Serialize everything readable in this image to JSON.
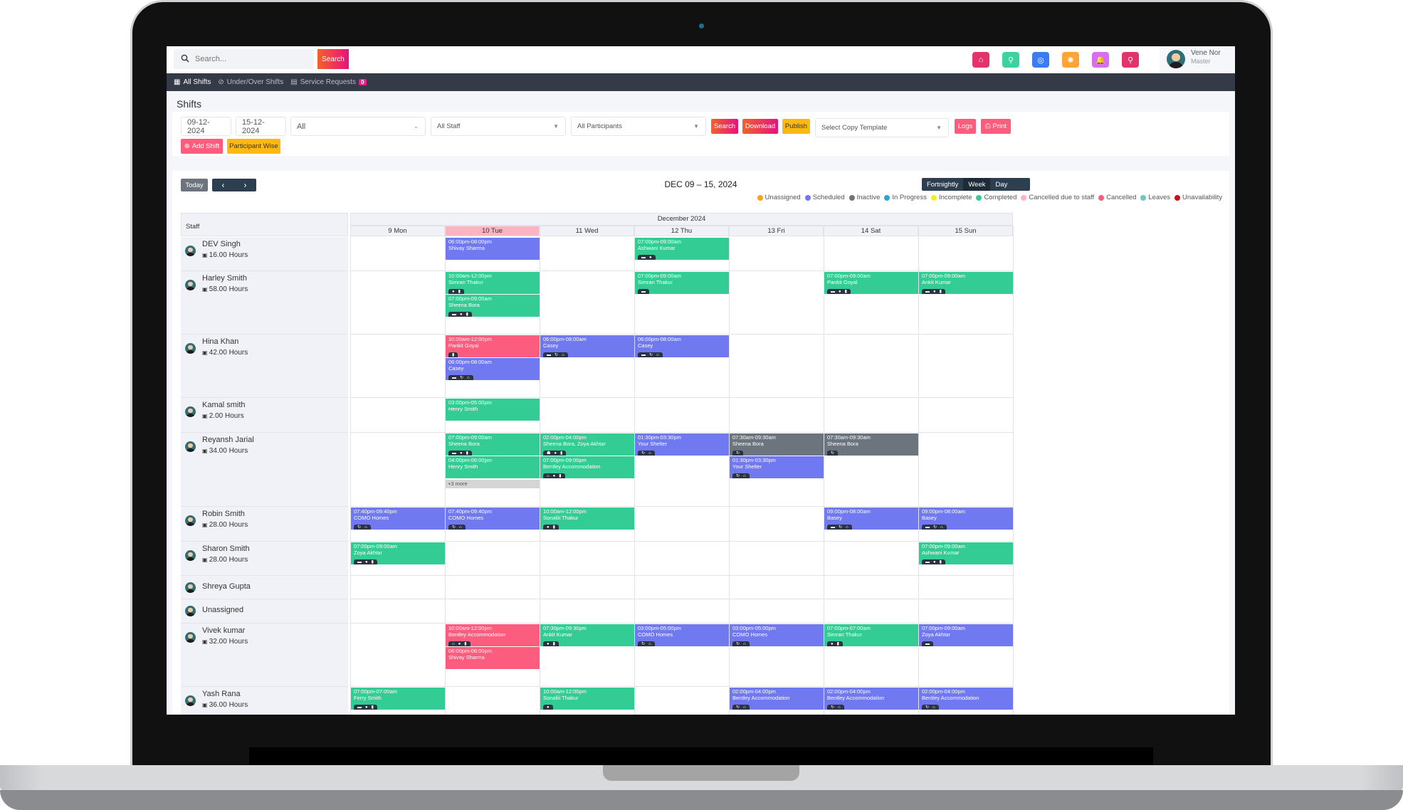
{
  "topbar": {
    "search_placeholder": "Search...",
    "search_button": "Search",
    "icons": [
      {
        "name": "home-icon",
        "glyph": "⌂",
        "color": "#e3336b"
      },
      {
        "name": "location-icon",
        "glyph": "⚲",
        "color": "#3bd3a0"
      },
      {
        "name": "lifebuoy-icon",
        "glyph": "◎",
        "color": "#3d7cf0"
      },
      {
        "name": "gear-icon",
        "glyph": "✺",
        "color": "#fea43b"
      },
      {
        "name": "bell-icon",
        "glyph": "🔔",
        "color": "#d76ef0"
      },
      {
        "name": "map-pin-icon",
        "glyph": "⚲",
        "color": "#e3336b"
      }
    ],
    "user_name": "Vene Nor",
    "user_role": "Master"
  },
  "nav": {
    "items": [
      {
        "label": "All Shifts",
        "icon": "▦",
        "active": true
      },
      {
        "label": "Under/Over Shifts",
        "icon": "⊘",
        "active": false
      },
      {
        "label": "Service Requests",
        "icon": "▤",
        "active": false,
        "badge": "0"
      }
    ]
  },
  "page": {
    "title": "Shifts"
  },
  "filters": {
    "start_date": "09-12-2024",
    "end_date": "15-12-2024",
    "status_select": "All",
    "staff_select": "All Staff",
    "participants_select": "All Participants",
    "search_label": "Search",
    "download_label": "Download",
    "publish_label": "Publish",
    "copy_template_placeholder": "Select Copy Template",
    "logs_label": "Logs",
    "print_label": "Print",
    "add_shift_label": "Add Shift",
    "participant_wise_label": "Participant Wise"
  },
  "calendar": {
    "today_label": "Today",
    "prev": "‹",
    "next": "›",
    "title": "DEC 09 – 15, 2024",
    "views": [
      "Fortnightly",
      "Week",
      "Day"
    ],
    "active_view": "Week",
    "staff_header": "Staff",
    "month_header": "December 2024",
    "days": [
      "9 Mon",
      "10 Tue",
      "11 Wed",
      "12 Thu",
      "13 Fri",
      "14 Sat",
      "15 Sun"
    ],
    "today_index": 1,
    "more_label": "+3 more"
  },
  "legend": [
    {
      "label": "Unassigned",
      "color": "#f7a21b"
    },
    {
      "label": "Scheduled",
      "color": "#7079f0"
    },
    {
      "label": "Inactive",
      "color": "#6c757d"
    },
    {
      "label": "In Progress",
      "color": "#2fa3d6"
    },
    {
      "label": "Incomplete",
      "color": "#f4ef1c"
    },
    {
      "label": "Completed",
      "color": "#33cc95"
    },
    {
      "label": "Cancelled due to staff",
      "color": "#fdb3c1"
    },
    {
      "label": "Cancelled",
      "color": "#fc5c7d"
    },
    {
      "label": "Leaves",
      "color": "#6fc7c0"
    },
    {
      "label": "Unavailability",
      "color": "#c0131e"
    }
  ],
  "staff": [
    {
      "name": "DEV Singh",
      "hours": "16.00 Hours"
    },
    {
      "name": "Harley Smith",
      "hours": "58.00 Hours"
    },
    {
      "name": "Hina Khan",
      "hours": "42.00 Hours"
    },
    {
      "name": "Kamal smith",
      "hours": "2.00 Hours"
    },
    {
      "name": "Reyansh Jarial",
      "hours": "34.00 Hours"
    },
    {
      "name": "Robin Smith",
      "hours": "28.00 Hours"
    },
    {
      "name": "Sharon Smith",
      "hours": "28.00 Hours"
    },
    {
      "name": "Shreya Gupta",
      "hours": ""
    },
    {
      "name": "Unassigned",
      "hours": ""
    },
    {
      "name": "Vivek kumar",
      "hours": "32.00 Hours"
    },
    {
      "name": "Yash Rana",
      "hours": "36.00 Hours"
    }
  ],
  "shifts": [
    {
      "staff": 0,
      "day": 1,
      "slot": 0,
      "time": "06:00pm-08:00pm",
      "who": "Shivay Sharma",
      "status": "scheduled",
      "icons": []
    },
    {
      "staff": 0,
      "day": 3,
      "slot": 0,
      "time": "07:00pm-09:00am",
      "who": "Ashwani Kumar",
      "status": "completed",
      "icons": [
        "bed",
        "check"
      ]
    },
    {
      "staff": 1,
      "day": 1,
      "slot": 0,
      "time": "10:00am-12:00pm",
      "who": "Simran Thakur",
      "status": "completed",
      "icons": [
        "check",
        "lock"
      ]
    },
    {
      "staff": 1,
      "day": 1,
      "slot": 1,
      "time": "07:00pm-09:00am",
      "who": "Sheena Bora",
      "status": "completed",
      "icons": [
        "bed",
        "check",
        "lock"
      ]
    },
    {
      "staff": 1,
      "day": 3,
      "slot": 0,
      "time": "07:00pm-09:00am",
      "who": "Simran Thakur",
      "status": "completed",
      "icons": [
        "bed"
      ]
    },
    {
      "staff": 1,
      "day": 5,
      "slot": 0,
      "time": "07:00pm-09:00am",
      "who": "Pankit Goyal",
      "status": "completed",
      "icons": [
        "bed",
        "check",
        "lock"
      ]
    },
    {
      "staff": 1,
      "day": 6,
      "slot": 0,
      "time": "07:00pm-09:00am",
      "who": "Ankit Kumar",
      "status": "completed",
      "icons": [
        "bed",
        "check",
        "lock"
      ]
    },
    {
      "staff": 2,
      "day": 1,
      "slot": 0,
      "time": "10:00am-12:00pm",
      "who": "Pankit Goyal",
      "status": "cancelled",
      "icons": [
        "lock"
      ]
    },
    {
      "staff": 2,
      "day": 1,
      "slot": 1,
      "time": "06:00pm-08:00am",
      "who": "Casey",
      "status": "scheduled",
      "icons": [
        "bed",
        "repeat",
        "home"
      ]
    },
    {
      "staff": 2,
      "day": 2,
      "slot": 0,
      "time": "06:00pm-08:00am",
      "who": "Casey",
      "status": "scheduled",
      "icons": [
        "bed",
        "repeat",
        "home"
      ]
    },
    {
      "staff": 2,
      "day": 3,
      "slot": 0,
      "time": "06:00pm-08:00am",
      "who": "Casey",
      "status": "scheduled",
      "icons": [
        "bed",
        "repeat",
        "home"
      ]
    },
    {
      "staff": 3,
      "day": 1,
      "slot": 0,
      "time": "03:00pm-05:00pm",
      "who": "Henry Smith",
      "status": "completed",
      "icons": []
    },
    {
      "staff": 4,
      "day": 1,
      "slot": 0,
      "time": "07:00pm-09:00am",
      "who": "Sheena Bora",
      "status": "completed",
      "icons": [
        "bed",
        "check",
        "lock"
      ]
    },
    {
      "staff": 4,
      "day": 1,
      "slot": 1,
      "time": "04:00pm-06:00pm",
      "who": "Henry Smith",
      "status": "completed",
      "icons": []
    },
    {
      "staff": 4,
      "day": 2,
      "slot": 0,
      "time": "02:00pm-04:00pm",
      "who": "Sheena Bora, Zoya Akhtar",
      "status": "completed",
      "icons": [
        "group",
        "check",
        "lock"
      ]
    },
    {
      "staff": 4,
      "day": 2,
      "slot": 1,
      "time": "07:00pm-09:00pm",
      "who": "Bentley Accommodation",
      "status": "completed",
      "icons": [
        "home",
        "check",
        "lock"
      ]
    },
    {
      "staff": 4,
      "day": 3,
      "slot": 0,
      "time": "01:30pm-03:30pm",
      "who": "Your Shelter",
      "status": "scheduled",
      "icons": [
        "repeat",
        "home"
      ]
    },
    {
      "staff": 4,
      "day": 4,
      "slot": 0,
      "time": "07:30am-09:30am",
      "who": "Sheena Bora",
      "status": "inactive",
      "icons": [
        "repeat"
      ]
    },
    {
      "staff": 4,
      "day": 4,
      "slot": 1,
      "time": "01:30pm-03:30pm",
      "who": "Your Shelter",
      "status": "scheduled",
      "icons": [
        "repeat",
        "home"
      ]
    },
    {
      "staff": 4,
      "day": 5,
      "slot": 0,
      "time": "07:30am-09:30am",
      "who": "Sheena Bora",
      "status": "inactive",
      "icons": [
        "repeat"
      ]
    },
    {
      "staff": 5,
      "day": 0,
      "slot": 0,
      "time": "07:40pm-09:40pm",
      "who": "COMO Homes",
      "status": "scheduled",
      "icons": [
        "repeat",
        "home"
      ]
    },
    {
      "staff": 5,
      "day": 1,
      "slot": 0,
      "time": "07:40pm-09:40pm",
      "who": "COMO Homes",
      "status": "scheduled",
      "icons": [
        "repeat",
        "home"
      ]
    },
    {
      "staff": 5,
      "day": 2,
      "slot": 0,
      "time": "10:00am-12:00pm",
      "who": "Sonaliii Thakur",
      "status": "completed",
      "icons": [
        "check",
        "lock"
      ]
    },
    {
      "staff": 5,
      "day": 5,
      "slot": 0,
      "time": "09:00pm-08:00am",
      "who": "Basey",
      "status": "scheduled",
      "icons": [
        "bed",
        "repeat",
        "home"
      ]
    },
    {
      "staff": 5,
      "day": 6,
      "slot": 0,
      "time": "09:00pm-08:00am",
      "who": "Basey",
      "status": "scheduled",
      "icons": [
        "bed",
        "repeat",
        "home"
      ]
    },
    {
      "staff": 6,
      "day": 0,
      "slot": 0,
      "time": "07:00pm-09:00am",
      "who": "Zoya Akhtar",
      "status": "completed",
      "icons": [
        "bed",
        "check",
        "lock"
      ]
    },
    {
      "staff": 6,
      "day": 6,
      "slot": 0,
      "time": "07:00pm-09:00am",
      "who": "Ashwani Kumar",
      "status": "completed",
      "icons": [
        "bed",
        "check",
        "lock"
      ]
    },
    {
      "staff": 9,
      "day": 1,
      "slot": 0,
      "time": "10:00am-12:00pm",
      "who": "Bentley Accommodation",
      "status": "cancelled",
      "icons": [
        "home",
        "check",
        "lock"
      ]
    },
    {
      "staff": 9,
      "day": 1,
      "slot": 1,
      "time": "06:00pm-08:00pm",
      "who": "Shivay Sharma",
      "status": "cancelled",
      "icons": []
    },
    {
      "staff": 9,
      "day": 2,
      "slot": 0,
      "time": "07:30pm-09:30pm",
      "who": "Ankit Kumar",
      "status": "completed",
      "icons": [
        "check",
        "lock"
      ]
    },
    {
      "staff": 9,
      "day": 3,
      "slot": 0,
      "time": "03:00pm-05:00pm",
      "who": "COMO Homes",
      "status": "scheduled",
      "icons": [
        "repeat",
        "home"
      ]
    },
    {
      "staff": 9,
      "day": 4,
      "slot": 0,
      "time": "03:00pm-05:00pm",
      "who": "COMO Homes",
      "status": "scheduled",
      "icons": [
        "repeat",
        "home"
      ]
    },
    {
      "staff": 9,
      "day": 5,
      "slot": 0,
      "time": "07:00pm-07:00am",
      "who": "Simran Thakur",
      "status": "completed",
      "icons": [
        "check",
        "lock"
      ]
    },
    {
      "staff": 9,
      "day": 6,
      "slot": 0,
      "time": "07:00pm-09:00am",
      "who": "Zoya Akhtar",
      "status": "scheduled",
      "icons": [
        "bed"
      ]
    },
    {
      "staff": 10,
      "day": 0,
      "slot": 0,
      "time": "07:00pm-07:00am",
      "who": "Ferry Smith",
      "status": "completed",
      "icons": [
        "bed",
        "check",
        "lock"
      ]
    },
    {
      "staff": 10,
      "day": 2,
      "slot": 0,
      "time": "10:00am-12:00pm",
      "who": "Sonaliii Thakur",
      "status": "completed",
      "icons": [
        "check"
      ]
    },
    {
      "staff": 10,
      "day": 4,
      "slot": 0,
      "time": "02:00pm-04:00pm",
      "who": "Bentley Accommodation",
      "status": "scheduled",
      "icons": [
        "repeat",
        "home"
      ]
    },
    {
      "staff": 10,
      "day": 5,
      "slot": 0,
      "time": "02:00pm-04:00pm",
      "who": "Bentley Accommodation",
      "status": "scheduled",
      "icons": [
        "repeat",
        "home"
      ]
    },
    {
      "staff": 10,
      "day": 6,
      "slot": 0,
      "time": "02:00pm-04:00pm",
      "who": "Bentley Accommodation",
      "status": "scheduled",
      "icons": [
        "repeat",
        "home"
      ]
    }
  ],
  "more_links": [
    {
      "staff": 4,
      "day": 1,
      "label": "+3 more"
    }
  ]
}
